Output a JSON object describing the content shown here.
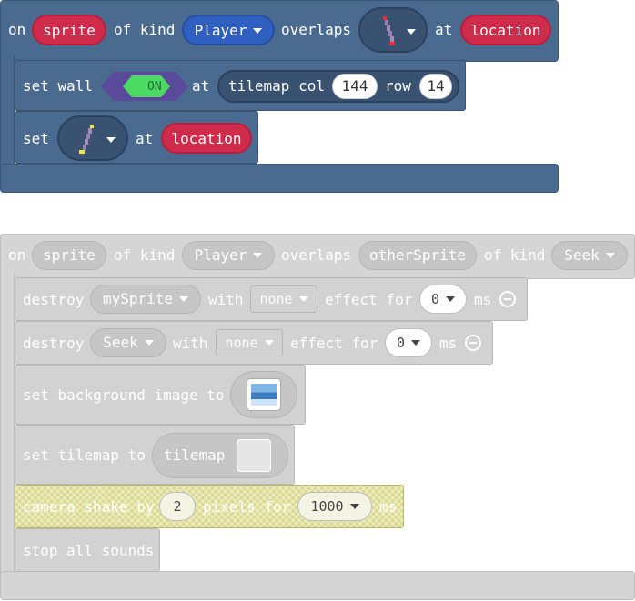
{
  "top_event": {
    "on": "on",
    "sprite": "sprite",
    "of_kind": "of kind",
    "kind": "Player",
    "overlaps": "overlaps",
    "at": "at",
    "location": "location"
  },
  "set_wall": {
    "label": "set wall",
    "toggle": "ON",
    "at": "at",
    "tilemap_col": "tilemap col",
    "col": "144",
    "row_label": "row",
    "row": "14"
  },
  "set_tile": {
    "label": "set",
    "at": "at",
    "location": "location"
  },
  "bottom_event": {
    "on": "on",
    "sprite": "sprite",
    "of_kind": "of kind",
    "kind": "Player",
    "overlaps": "overlaps",
    "other_sprite": "otherSprite",
    "of_kind2": "of kind",
    "kind2": "Seek"
  },
  "destroy1": {
    "label": "destroy",
    "target": "mySprite",
    "with": "with",
    "effect": "none",
    "effect_for": "effect for",
    "duration": "0",
    "unit": "ms"
  },
  "destroy2": {
    "label": "destroy",
    "target": "Seek",
    "with": "with",
    "effect": "none",
    "effect_for": "effect for",
    "duration": "0",
    "unit": "ms"
  },
  "set_bg": {
    "label": "set background image to"
  },
  "set_tilemap": {
    "label": "set tilemap to",
    "value": "tilemap"
  },
  "camera_shake": {
    "label": "camera shake by",
    "amount": "2",
    "pixels_for": "pixels for",
    "duration": "1000",
    "unit": "ms"
  },
  "stop_sounds": {
    "label": "stop all sounds"
  },
  "colors": {
    "event_blue": "#4b6a8f",
    "red_pill": "#cf2b4b",
    "blue_pill": "#2f5fc0",
    "disabled_grey": "#d2d2d2",
    "toggle_green": "#4cd964",
    "toggle_purple": "#5b4a9b",
    "highlight_yellow": "#d9d98a"
  }
}
